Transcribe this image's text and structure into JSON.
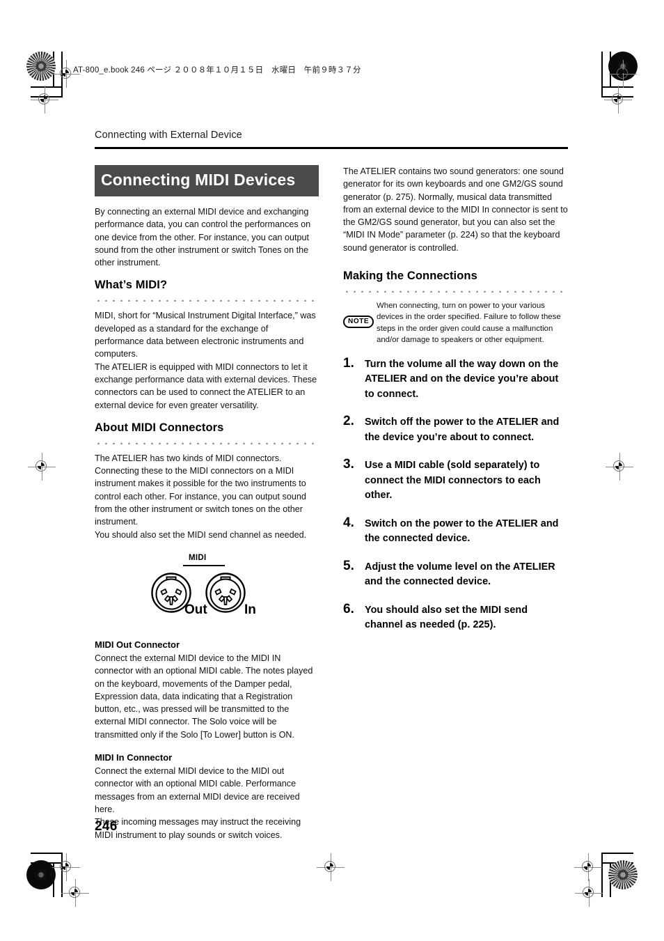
{
  "file_header": "AT-800_e.book  246 ページ  ２００８年１０月１５日　水曜日　午前９時３７分",
  "running_head": "Connecting with External Device",
  "banner_title": "Connecting MIDI Devices",
  "folio": "246",
  "left_column": {
    "intro": "By connecting an external MIDI device and exchanging performance data, you can control the performances on one device from the other. For instance, you can output sound from the other instrument or switch Tones on the other instrument.",
    "whats_midi": {
      "heading": "What’s MIDI?",
      "paragraph_1": "MIDI, short for “Musical Instrument Digital Interface,” was developed as a standard for the exchange of performance data between electronic instruments and computers.",
      "paragraph_2": "The ATELIER is equipped with MIDI connectors to let it exchange performance data with external devices. These connectors can be used to connect the ATELIER to an external device for even greater versatility."
    },
    "about_connectors": {
      "heading": "About MIDI Connectors",
      "paragraph_1": "The ATELIER has two kinds of MIDI connectors.",
      "paragraph_2": "Connecting these to the MIDI connectors on a MIDI instrument makes it possible for the two instruments to control each other. For instance, you can output sound from the other instrument or switch tones on the other instrument.",
      "paragraph_3": "You should also set the MIDI send channel as needed."
    },
    "figure": {
      "caption": "MIDI",
      "jack_out_label": "Out",
      "jack_in_label": "In"
    },
    "midi_out_connector": {
      "heading": "MIDI Out Connector",
      "paragraph": "Connect the external MIDI device to the MIDI IN connector with an optional MIDI cable. The notes played on the keyboard, movements of the Damper pedal, Expression data, data indicating that a Registration button, etc., was pressed will be transmitted to the external MIDI connector. The Solo voice will be transmitted only if the Solo [To Lower] button is ON."
    },
    "midi_in_connector": {
      "heading": "MIDI In Connector",
      "paragraph_1": "Connect the external MIDI device to the MIDI out connector with an optional MIDI cable. Performance messages from an external MIDI device are received here.",
      "paragraph_2": "These incoming messages may instruct the receiving MIDI instrument to play sounds or switch voices."
    }
  },
  "right_column": {
    "intro": "The ATELIER contains two sound generators: one sound generator for its own keyboards and one GM2/GS sound generator (p. 275). Normally, musical data transmitted from an external device to the MIDI In connector is sent to the GM2/GS sound generator, but you can also set the “MIDI IN Mode” parameter (p. 224) so that the keyboard sound generator is controlled.",
    "making_connections": {
      "heading": "Making the Connections",
      "note_badge": "NOTE",
      "note_text": "When connecting, turn on power to your various devices in the order specified. Failure to follow these steps in the order given could cause a malfunction and/or damage to speakers or other equipment.",
      "steps": [
        {
          "number": "1.",
          "text": "Turn the volume all the way down on the ATELIER and on the device you’re about to connect."
        },
        {
          "number": "2.",
          "text": "Switch off the power to the ATELIER and the device you’re about to connect."
        },
        {
          "number": "3.",
          "text": "Use a MIDI cable (sold separately) to connect the MIDI connectors to each other."
        },
        {
          "number": "4.",
          "text": "Switch on the power to the ATELIER and the connected device."
        },
        {
          "number": "5.",
          "text": "Adjust the volume level on the ATELIER and the connected device."
        },
        {
          "number": "6.",
          "text": "You should also set the MIDI send channel as needed (p. 225)."
        }
      ]
    }
  },
  "colors": {
    "banner_background": "#4a4a4a",
    "banner_text": "#ffffff",
    "body_text": "#111111",
    "rule": "#000000",
    "dot_rule": "#8d8d8d"
  }
}
